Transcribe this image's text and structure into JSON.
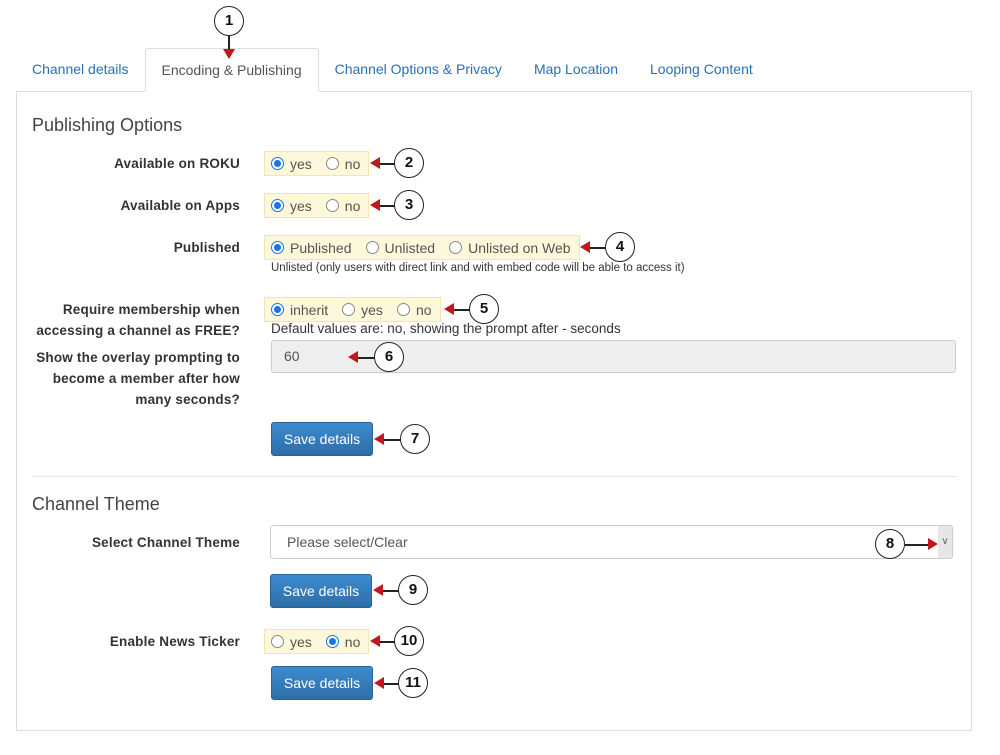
{
  "tabs": [
    {
      "label": "Channel details",
      "active": false
    },
    {
      "label": "Encoding & Publishing",
      "active": true
    },
    {
      "label": "Channel Options & Privacy",
      "active": false
    },
    {
      "label": "Map Location",
      "active": false
    },
    {
      "label": "Looping Content",
      "active": false
    }
  ],
  "publishing": {
    "title": "Publishing Options",
    "roku": {
      "label": "Available on ROKU",
      "options": [
        "yes",
        "no"
      ],
      "selected": "yes"
    },
    "apps": {
      "label": "Available on Apps",
      "options": [
        "yes",
        "no"
      ],
      "selected": "yes"
    },
    "published": {
      "label": "Published",
      "options": [
        "Published",
        "Unlisted",
        "Unlisted on Web"
      ],
      "selected": "Published",
      "help": "Unlisted (only users with direct link and with embed code will be able to access it)"
    },
    "membership": {
      "label_line1": "Require membership when",
      "label_line2": "accessing a channel as FREE?",
      "options": [
        "inherit",
        "yes",
        "no"
      ],
      "selected": "inherit",
      "help": "Default values are: no, showing the prompt after - seconds"
    },
    "overlay": {
      "label_line1": "Show the overlay prompting to",
      "label_line2": "become a member after how",
      "label_line3": "many seconds?",
      "value": "60"
    },
    "save_label": "Save details"
  },
  "theme": {
    "title": "Channel Theme",
    "select_label": "Select Channel Theme",
    "select_value": "Please select/Clear",
    "save_label": "Save details",
    "ticker": {
      "label": "Enable News Ticker",
      "options": [
        "yes",
        "no"
      ],
      "selected": "no"
    },
    "save2_label": "Save details"
  },
  "callouts": [
    "1",
    "2",
    "3",
    "4",
    "5",
    "6",
    "7",
    "8",
    "9",
    "10",
    "11"
  ],
  "colors": {
    "accent": "#337ab7",
    "highlight": "#fdf8d9",
    "arrow": "#c0181f"
  }
}
